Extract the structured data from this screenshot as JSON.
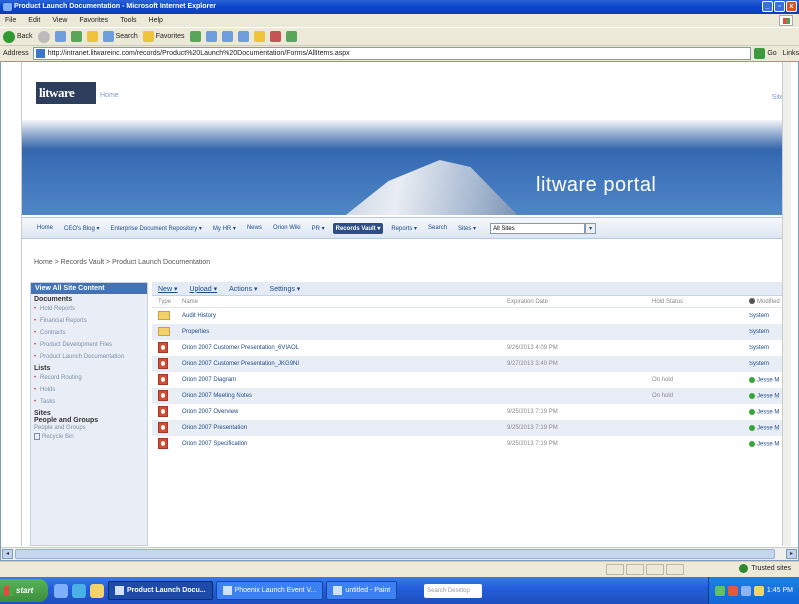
{
  "window": {
    "title": "Product Launch Documentation - Microsoft Internet Explorer",
    "buttons": {
      "minimize": "_",
      "maximize": "▫",
      "close": "x"
    }
  },
  "menu": [
    "File",
    "Edit",
    "View",
    "Favorites",
    "Tools",
    "Help"
  ],
  "toolbar": {
    "back": "Back",
    "search": "Search",
    "favorites": "Favorites"
  },
  "address": {
    "label": "Address",
    "url": "http://intranet.litwareinc.com/records/Product%20Launch%20Documentation/Forms/AllItems.aspx",
    "go": "Go",
    "links": "Links"
  },
  "site": {
    "logo": "litware",
    "home_link": "Home",
    "site_actions": "Site A",
    "portal_title": "litware portal"
  },
  "topnav": {
    "items": [
      "Home",
      "CEO's Blog ▾",
      "Enterprise Document Repository ▾",
      "My HR ▾",
      "News",
      "Orion Wiki",
      "PR ▾",
      "Records Vault ▾",
      "Reports ▾",
      "Search",
      "Sites ▾"
    ],
    "selected_index": 7,
    "scope": "All Sites"
  },
  "breadcrumb": "Home > Records Vault > Product Launch Documentation",
  "quicklaunch": {
    "view_all": "View All Site Content",
    "documents_head": "Documents",
    "documents": [
      "Hold Reports",
      "Financial Reports",
      "Contracts",
      "Product Development Files",
      "Product Launch Documentation"
    ],
    "lists_head": "Lists",
    "lists": [
      "Record Routing",
      "Holds",
      "Tasks"
    ],
    "sites_head": "Sites",
    "people_head": "People and Groups",
    "people_link": "People and Groups",
    "recycle_bin": "Recycle Bin"
  },
  "list_toolbar": {
    "new": "New ▾",
    "upload": "Upload ▾",
    "actions": "Actions ▾",
    "settings": "Settings ▾"
  },
  "columns": {
    "type": "Type",
    "name": "Name",
    "expiration": "Expiration Date",
    "hold": "Hold Status",
    "modified": "Modified"
  },
  "rows": [
    {
      "icon": "folder",
      "name": "Audit History",
      "expiration": "",
      "hold": "",
      "modified": "System",
      "presence": false
    },
    {
      "icon": "folder",
      "name": "Properties",
      "expiration": "",
      "hold": "",
      "modified": "System",
      "presence": false
    },
    {
      "icon": "pptx",
      "name": "Orion 2007 Customer Presentation_6VIAOL",
      "expiration": "9/26/2013 4:09 PM",
      "hold": "",
      "modified": "System",
      "presence": false
    },
    {
      "icon": "pptx",
      "name": "Orion 2007 Customer Presentation_JKG9NI",
      "expiration": "9/27/2013 3:40 PM",
      "hold": "",
      "modified": "System",
      "presence": false
    },
    {
      "icon": "pptx",
      "name": "Orion 2007 Diagram",
      "expiration": "",
      "hold": "On hold",
      "modified": "Jesse M",
      "presence": true
    },
    {
      "icon": "pptx",
      "name": "Orion 2007 Meeting Notes",
      "expiration": "",
      "hold": "On hold",
      "modified": "Jesse M",
      "presence": true
    },
    {
      "icon": "pptx",
      "name": "Orion 2007 Overview",
      "expiration": "9/25/2013 7:19 PM",
      "hold": "",
      "modified": "Jesse M",
      "presence": true
    },
    {
      "icon": "pptx",
      "name": "Orion 2007 Presentation",
      "expiration": "9/25/2013 7:19 PM",
      "hold": "",
      "modified": "Jesse M",
      "presence": true
    },
    {
      "icon": "pptx",
      "name": "Orion 2007 Specification",
      "expiration": "9/25/2013 7:19 PM",
      "hold": "",
      "modified": "Jesse M",
      "presence": true
    }
  ],
  "statusbar": {
    "zone": "Trusted sites"
  },
  "taskbar": {
    "start": "start",
    "tasks": [
      "Product Launch Docu...",
      "Phoenix Launch Event V...",
      "untitled - Paint"
    ],
    "active_index": 0,
    "search_placeholder": "Search Desktop",
    "clock": "1:45 PM"
  },
  "colors": {
    "titlebar": "#0a46c8",
    "banner": "#3a6fb7",
    "nav_selected": "#2d4f86",
    "quicklaunch_header": "#4472b4",
    "alt_row": "#e9eef6",
    "presence": "#38a538"
  }
}
